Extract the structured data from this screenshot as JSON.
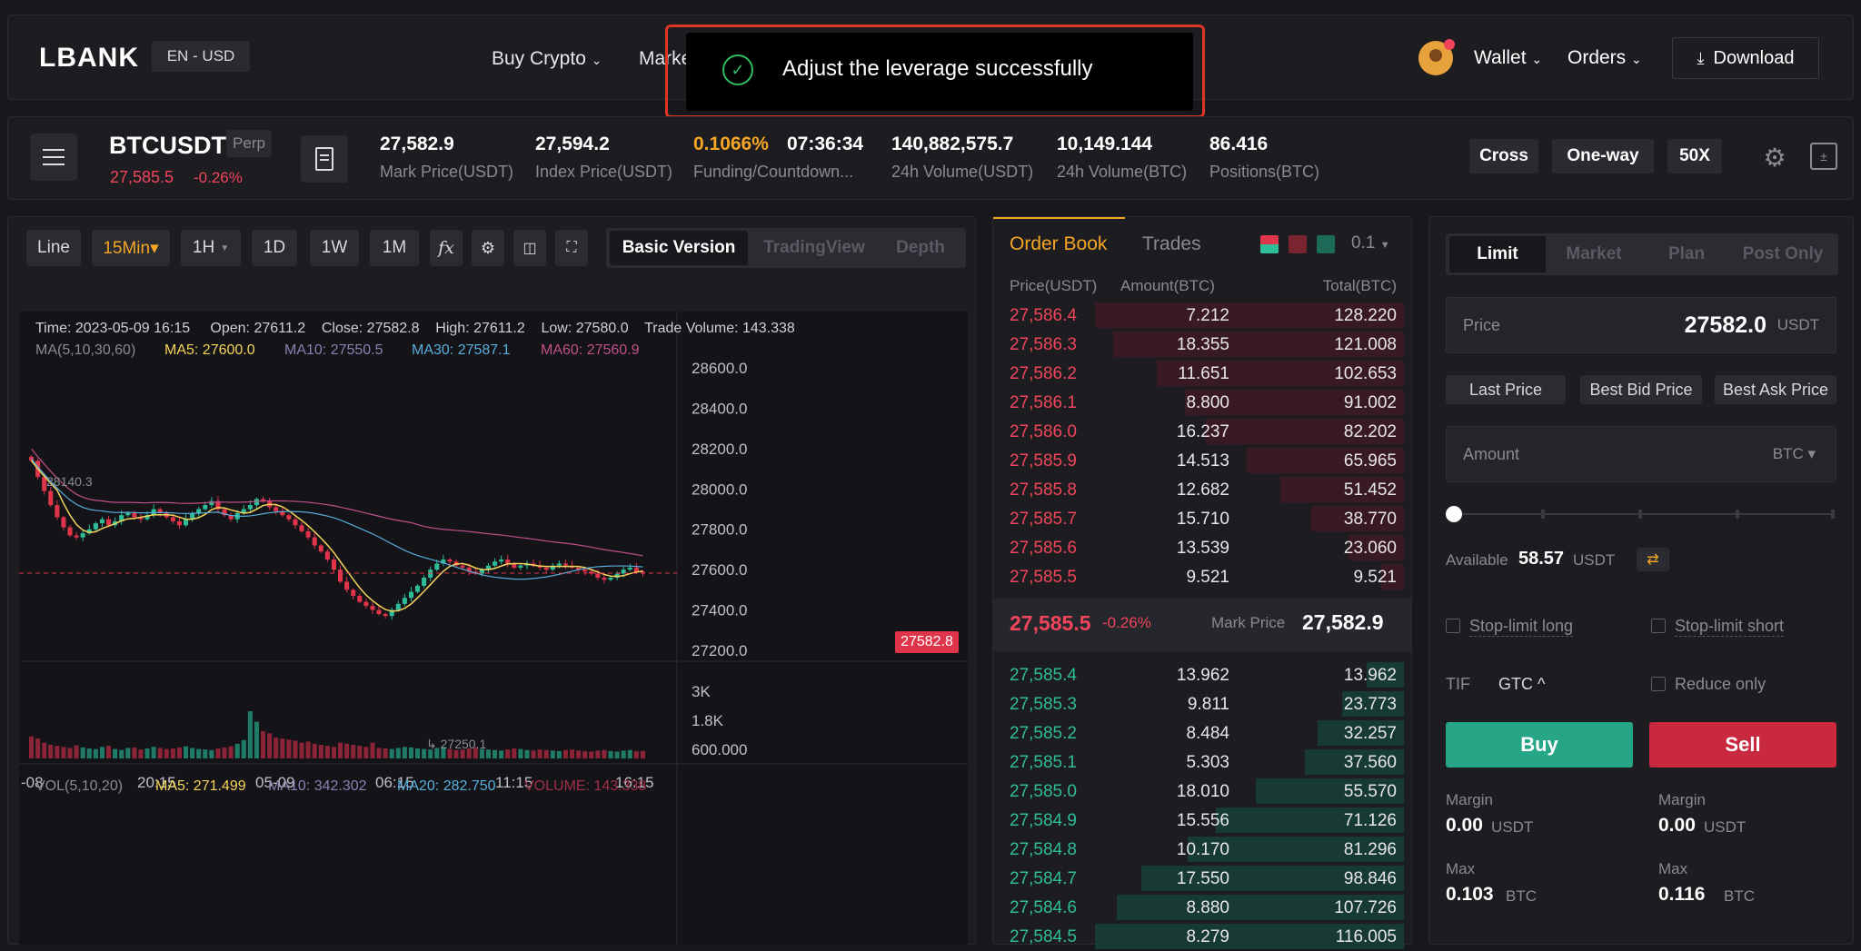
{
  "header": {
    "logo": "LBANK",
    "locale": "EN - USD",
    "nav": [
      "Buy Crypto",
      "Marke"
    ],
    "wallet": "Wallet",
    "orders": "Orders",
    "download": "Download",
    "toast": "Adjust the leverage successfully"
  },
  "ticker": {
    "symbol": "BTCUSDT",
    "tag": "Perp",
    "last_price": "27,585.5",
    "change": "-0.26%",
    "stats": [
      {
        "value": "27,582.9",
        "label": "Mark Price(USDT)"
      },
      {
        "value": "27,594.2",
        "label": "Index Price(USDT)"
      },
      {
        "value": "0.1066%",
        "value2": "07:36:34",
        "label": "Funding/Countdown..."
      },
      {
        "value": "140,882,575.7",
        "label": "24h Volume(USDT)"
      },
      {
        "value": "10,149.144",
        "label": "24h Volume(BTC)"
      },
      {
        "value": "86.416",
        "label": "Positions(BTC)"
      }
    ],
    "cross": "Cross",
    "oneway": "One-way",
    "leverage": "50X"
  },
  "chart_toolbar": {
    "line": "Line",
    "interval": "15Min▾",
    "h1": "1H",
    "d1": "1D",
    "w1": "1W",
    "m1": "1M",
    "fx": "fx",
    "versions": [
      "Basic Version",
      "TradingView",
      "Depth"
    ]
  },
  "chart_info": {
    "line1": "Time: 2023-05-09 16:15     Open: 27611.2    Close: 27582.8    High: 27611.2    Low: 27580.0    Trade Volume: 143.338",
    "ma_label": "MA(5,10,30,60)",
    "ma5": "MA5: 27600.0",
    "ma10": "MA10: 27550.5",
    "ma30": "MA30: 27587.1",
    "ma60": "MA60: 27560.9",
    "vol_label": "VOL(5,10,20)",
    "vma5": "MA5: 271.499",
    "vma10": "MA10: 342.302",
    "vma20": "MA20: 282.750",
    "volume": "VOLUME: 143.338",
    "high_mark": "28140.3",
    "low_mark": "27250.1",
    "price_tag": "27582.8"
  },
  "chart_data": {
    "type": "candlestick",
    "y_ticks": [
      "28600.0",
      "28400.0",
      "28200.0",
      "28000.0",
      "27800.0",
      "27600.0",
      "27400.0",
      "27200.0"
    ],
    "vol_ticks": [
      "3K",
      "1.8K",
      "600.000"
    ],
    "x_ticks": [
      "-08",
      "20:15",
      "05-09",
      "06:15",
      "11:15",
      "16:15"
    ],
    "ylim": [
      27150,
      28700
    ],
    "close": [
      28140,
      28060,
      27990,
      27920,
      27860,
      27810,
      27770,
      27760,
      27780,
      27800,
      27830,
      27850,
      27820,
      27840,
      27870,
      27880,
      27860,
      27850,
      27870,
      27900,
      27880,
      27860,
      27840,
      27820,
      27850,
      27880,
      27900,
      27920,
      27940,
      27900,
      27870,
      27850,
      27880,
      27900,
      27920,
      27950,
      27940,
      27910,
      27890,
      27870,
      27850,
      27820,
      27790,
      27760,
      27720,
      27690,
      27650,
      27600,
      27540,
      27500,
      27470,
      27440,
      27420,
      27400,
      27380,
      27370,
      27400,
      27430,
      27460,
      27490,
      27520,
      27560,
      27600,
      27630,
      27650,
      27640,
      27620,
      27610,
      27590,
      27580,
      27600,
      27620,
      27640,
      27650,
      27630,
      27610,
      27620,
      27630,
      27620,
      27610,
      27600,
      27620,
      27630,
      27620,
      27610,
      27600,
      27590,
      27580,
      27560,
      27550,
      27560,
      27580,
      27600,
      27610,
      27590,
      27582.8
    ],
    "volume": [
      420,
      380,
      300,
      260,
      240,
      220,
      200,
      250,
      210,
      190,
      180,
      220,
      240,
      180,
      160,
      200,
      210,
      170,
      190,
      220,
      200,
      180,
      190,
      210,
      230,
      200,
      180,
      170,
      160,
      190,
      210,
      230,
      280,
      350,
      900,
      700,
      520,
      480,
      400,
      380,
      360,
      340,
      300,
      320,
      280,
      260,
      240,
      220,
      300,
      280,
      260,
      240,
      220,
      300,
      200,
      190,
      180,
      200,
      220,
      210,
      190,
      180,
      170,
      200,
      220,
      180,
      160,
      170,
      190,
      210,
      180,
      170,
      160,
      150,
      170,
      190,
      180,
      160,
      150,
      170,
      160,
      150,
      140,
      160,
      170,
      150,
      140,
      130,
      150,
      160,
      140,
      130,
      150,
      160,
      140,
      143
    ]
  },
  "orderbook": {
    "tabs": [
      "Order Book",
      "Trades"
    ],
    "precision": "0.1",
    "headers": [
      "Price(USDT)",
      "Amount(BTC)",
      "Total(BTC)"
    ],
    "asks": [
      [
        "27,586.4",
        "7.212",
        "128.220"
      ],
      [
        "27,586.3",
        "18.355",
        "121.008"
      ],
      [
        "27,586.2",
        "11.651",
        "102.653"
      ],
      [
        "27,586.1",
        "8.800",
        "91.002"
      ],
      [
        "27,586.0",
        "16.237",
        "82.202"
      ],
      [
        "27,585.9",
        "14.513",
        "65.965"
      ],
      [
        "27,585.8",
        "12.682",
        "51.452"
      ],
      [
        "27,585.7",
        "15.710",
        "38.770"
      ],
      [
        "27,585.6",
        "13.539",
        "23.060"
      ],
      [
        "27,585.5",
        "9.521",
        "9.521"
      ]
    ],
    "mid_price": "27,585.5",
    "mid_change": "-0.26%",
    "mark_label": "Mark Price",
    "mark_price": "27,582.9",
    "bids": [
      [
        "27,585.4",
        "13.962",
        "13.962"
      ],
      [
        "27,585.3",
        "9.811",
        "23.773"
      ],
      [
        "27,585.2",
        "8.484",
        "32.257"
      ],
      [
        "27,585.1",
        "5.303",
        "37.560"
      ],
      [
        "27,585.0",
        "18.010",
        "55.570"
      ],
      [
        "27,584.9",
        "15.556",
        "71.126"
      ],
      [
        "27,584.8",
        "10.170",
        "81.296"
      ],
      [
        "27,584.7",
        "17.550",
        "98.846"
      ],
      [
        "27,584.6",
        "8.880",
        "107.726"
      ],
      [
        "27,584.5",
        "8.279",
        "116.005"
      ]
    ],
    "ask_depth": [
      1.0,
      0.94,
      0.8,
      0.71,
      0.64,
      0.51,
      0.4,
      0.3,
      0.18,
      0.074
    ],
    "bid_depth": [
      0.12,
      0.2,
      0.28,
      0.32,
      0.48,
      0.61,
      0.7,
      0.85,
      0.93,
      1.0
    ]
  },
  "order_form": {
    "tabs": [
      "Limit",
      "Market",
      "Plan",
      "Post Only"
    ],
    "price_label": "Price",
    "price_value": "27582.0",
    "price_unit": "USDT",
    "quick": [
      "Last Price",
      "Best Bid Price",
      "Best Ask Price"
    ],
    "amount_label": "Amount",
    "amount_unit": "BTC ▾",
    "available_label": "Available",
    "available_value": "58.57",
    "available_unit": "USDT",
    "stop_long": "Stop-limit long",
    "stop_short": "Stop-limit short",
    "tif_label": "TIF",
    "tif_value": "GTC ^",
    "reduce_only": "Reduce only",
    "buy": "Buy",
    "sell": "Sell",
    "margin_label": "Margin",
    "margin_buy": "0.00",
    "margin_sell": "0.00",
    "margin_unit": "USDT",
    "max_label": "Max",
    "max_buy": "0.103",
    "max_sell": "0.116",
    "max_unit": "BTC"
  }
}
